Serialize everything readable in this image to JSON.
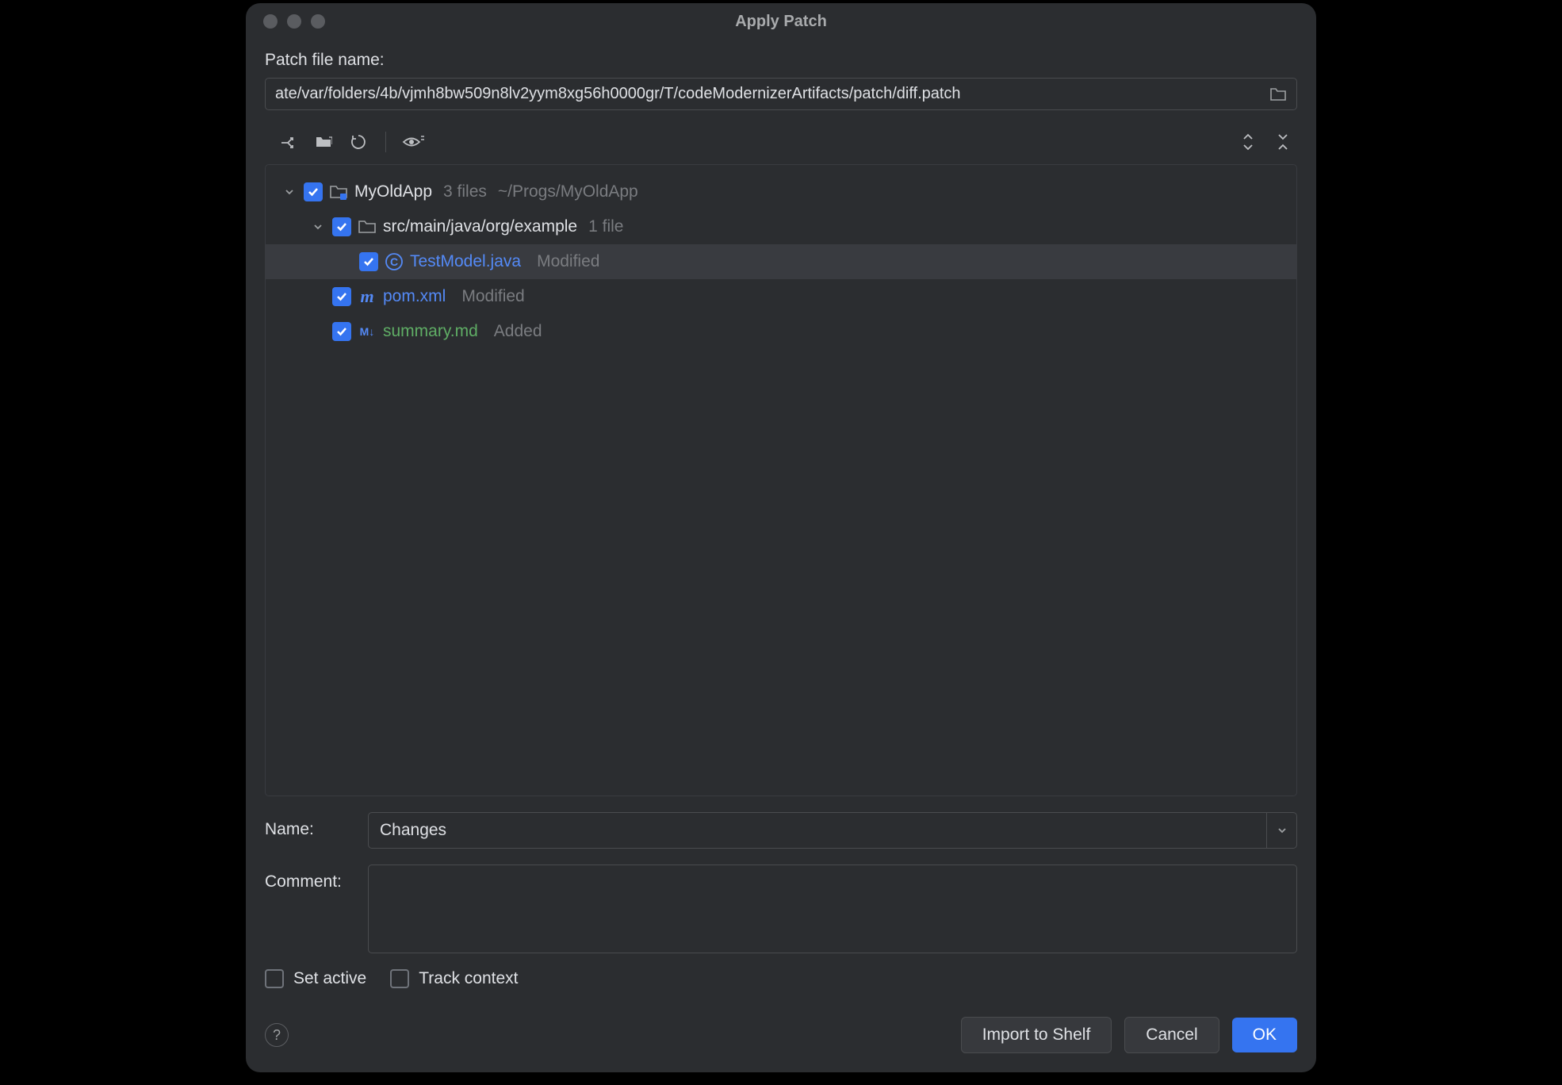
{
  "dialog": {
    "title": "Apply Patch",
    "patchFileLabel": "Patch file name:",
    "patchFilePath": "ate/var/folders/4b/vjmh8bw509n8lv2yym8xg56h0000gr/T/codeModernizerArtifacts/patch/diff.patch"
  },
  "tree": {
    "root": {
      "name": "MyOldApp",
      "filesCount": "3 files",
      "path": "~/Progs/MyOldApp"
    },
    "folder": {
      "name": "src/main/java/org/example",
      "filesCount": "1 file"
    },
    "file1": {
      "name": "TestModel.java",
      "status": "Modified"
    },
    "file2": {
      "name": "pom.xml",
      "status": "Modified"
    },
    "file3": {
      "name": "summary.md",
      "status": "Added"
    }
  },
  "form": {
    "nameLabel": "Name:",
    "nameValue": "Changes",
    "commentLabel": "Comment:",
    "commentValue": "",
    "setActiveLabel": "Set active",
    "trackContextLabel": "Track context"
  },
  "buttons": {
    "importShelf": "Import to Shelf",
    "cancel": "Cancel",
    "ok": "OK",
    "help": "?"
  },
  "iconLabels": {
    "mdBadge": "M↓",
    "mavenBadge": "m",
    "javaBadge": "C"
  }
}
